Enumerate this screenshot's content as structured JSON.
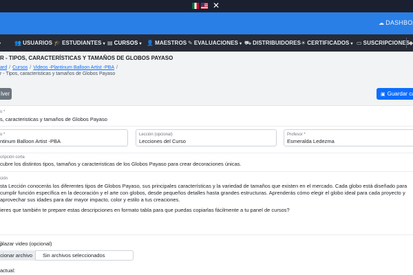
{
  "topbar": {
    "flags": [
      "mexico-flag",
      "usa-flag"
    ],
    "close_symbol": "✕"
  },
  "header": {
    "dashboard_label": "DASHBOARD"
  },
  "nav": {
    "items": [
      {
        "label": "USUARIOS",
        "icon": "users-icon"
      },
      {
        "label": "ESTUDIANTES",
        "icon": "graduate-icon",
        "dropdown": true
      },
      {
        "label": "CURSOS",
        "icon": "book-icon",
        "dropdown": true,
        "active": true
      },
      {
        "label": "MAESTROS",
        "icon": "teacher-icon"
      },
      {
        "label": "EVALUACIONES",
        "icon": "edit-icon",
        "dropdown": true
      },
      {
        "label": "DISTRIBUIDORES",
        "icon": "truck-icon"
      },
      {
        "label": "CERTIFICADOS",
        "icon": "lightbulb-icon",
        "dropdown": true
      },
      {
        "label": "SUSCRIPCIONES",
        "icon": "card-icon"
      }
    ]
  },
  "page": {
    "title": "R - TIPOS, CARACTERÍSTICAS Y TAMAÑOS DE GLOBOS PAYASO",
    "breadcrumb": [
      "ard",
      "Cursos",
      "Videos -Plantinum Balloon Artist -PBA"
    ],
    "breadcrumb_current": "r - Tipos, caracteristicas y tamaños de Globos Payaso"
  },
  "actions": {
    "back_label": "lver",
    "save_label": "Guardar ca"
  },
  "form": {
    "title_label": "o *",
    "title_value": "s, caracteristicas y tamaños de Globos Payaso",
    "course_label": "o *",
    "course_value": "ntinum Balloon Artist -PBA",
    "lesson_label": "Lección (opcional)",
    "lesson_value": "Lecciones del Curso",
    "teacher_label": "Profesor *",
    "teacher_value": "Esmeralda Ledezma",
    "short_desc_label": "cripción corta",
    "short_desc_value": "cubre los distintos tipos, tamaños y caracteristicas de los Globos Payaso para crear decoraciones únicas.",
    "desc_label": "ción",
    "desc_paragraph": "sta Lección conocerás los diferentes tipos de Globos Payaso, sus principales características y la variedad de tamaños que existen en el mercado. Cada globo está diseñado para cumplir función específica en la decoración y el arte con globos, desde pequeños detalles hasta grandes estructuras. Aprenderás cómo elegir el globo ideal para cada proyecto y aprovechar sus idades para dar mayor impacto, color y estilo a tus creaciones.",
    "desc_question": "ieres que también te prepare estas descripciones en formato tabla para que puedas copiarlas fácilmente a tu panel de cursos?",
    "replace_video_label": "plazar video (opcional)",
    "file_button": "ccionar archivo",
    "file_status": "Sin archivos seleccionados",
    "current_label": "actual:"
  }
}
